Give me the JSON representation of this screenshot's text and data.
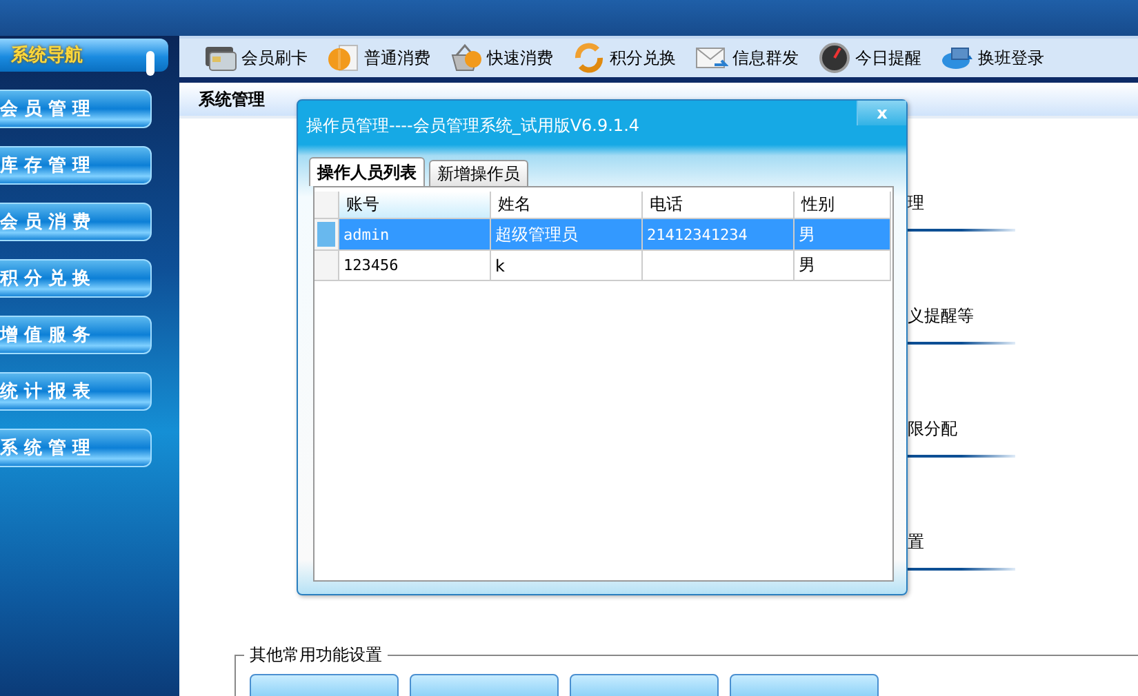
{
  "sidebar": {
    "title": "系统导航",
    "items": [
      {
        "label": "会 员 管 理"
      },
      {
        "label": "库 存 管 理"
      },
      {
        "label": "会 员 消 费"
      },
      {
        "label": "积 分 兑 换"
      },
      {
        "label": "增 值 服 务"
      },
      {
        "label": "统 计 报 表"
      },
      {
        "label": "系 统 管 理"
      }
    ]
  },
  "toolbar": [
    {
      "kind": "card",
      "label": "会员刷卡"
    },
    {
      "kind": "dollar",
      "label": "普通消费"
    },
    {
      "kind": "basket",
      "label": "快速消费"
    },
    {
      "kind": "refresh",
      "label": "积分兑换"
    },
    {
      "kind": "mail",
      "label": "信息群发"
    },
    {
      "kind": "gauge",
      "label": "今日提醒"
    },
    {
      "kind": "swap",
      "label": "换班登录"
    }
  ],
  "content": {
    "tab": "系统管理",
    "sections": [
      "理",
      "义提醒等",
      "限分配",
      "置"
    ],
    "fieldset": {
      "legend": "其他常用功能设置",
      "buttons": [
        {
          "kind": "button"
        },
        {
          "kind": "button"
        },
        {
          "kind": "button"
        },
        {
          "kind": "button"
        }
      ]
    }
  },
  "dialog": {
    "title": "操作员管理----会员管理系统_试用版V6.9.1.4",
    "close": "x",
    "tabs": [
      {
        "label": "操作人员列表",
        "selected": true
      },
      {
        "label": "新增操作员",
        "selected": false
      }
    ],
    "table": {
      "columns": [
        "账号",
        "姓名",
        "电话",
        "性别"
      ],
      "rows": [
        {
          "cells": [
            "admin",
            "超级管理员",
            "21412341234",
            "男"
          ],
          "selected": true
        },
        {
          "cells": [
            "123456",
            "k",
            "",
            "男"
          ],
          "selected": false
        }
      ]
    }
  }
}
